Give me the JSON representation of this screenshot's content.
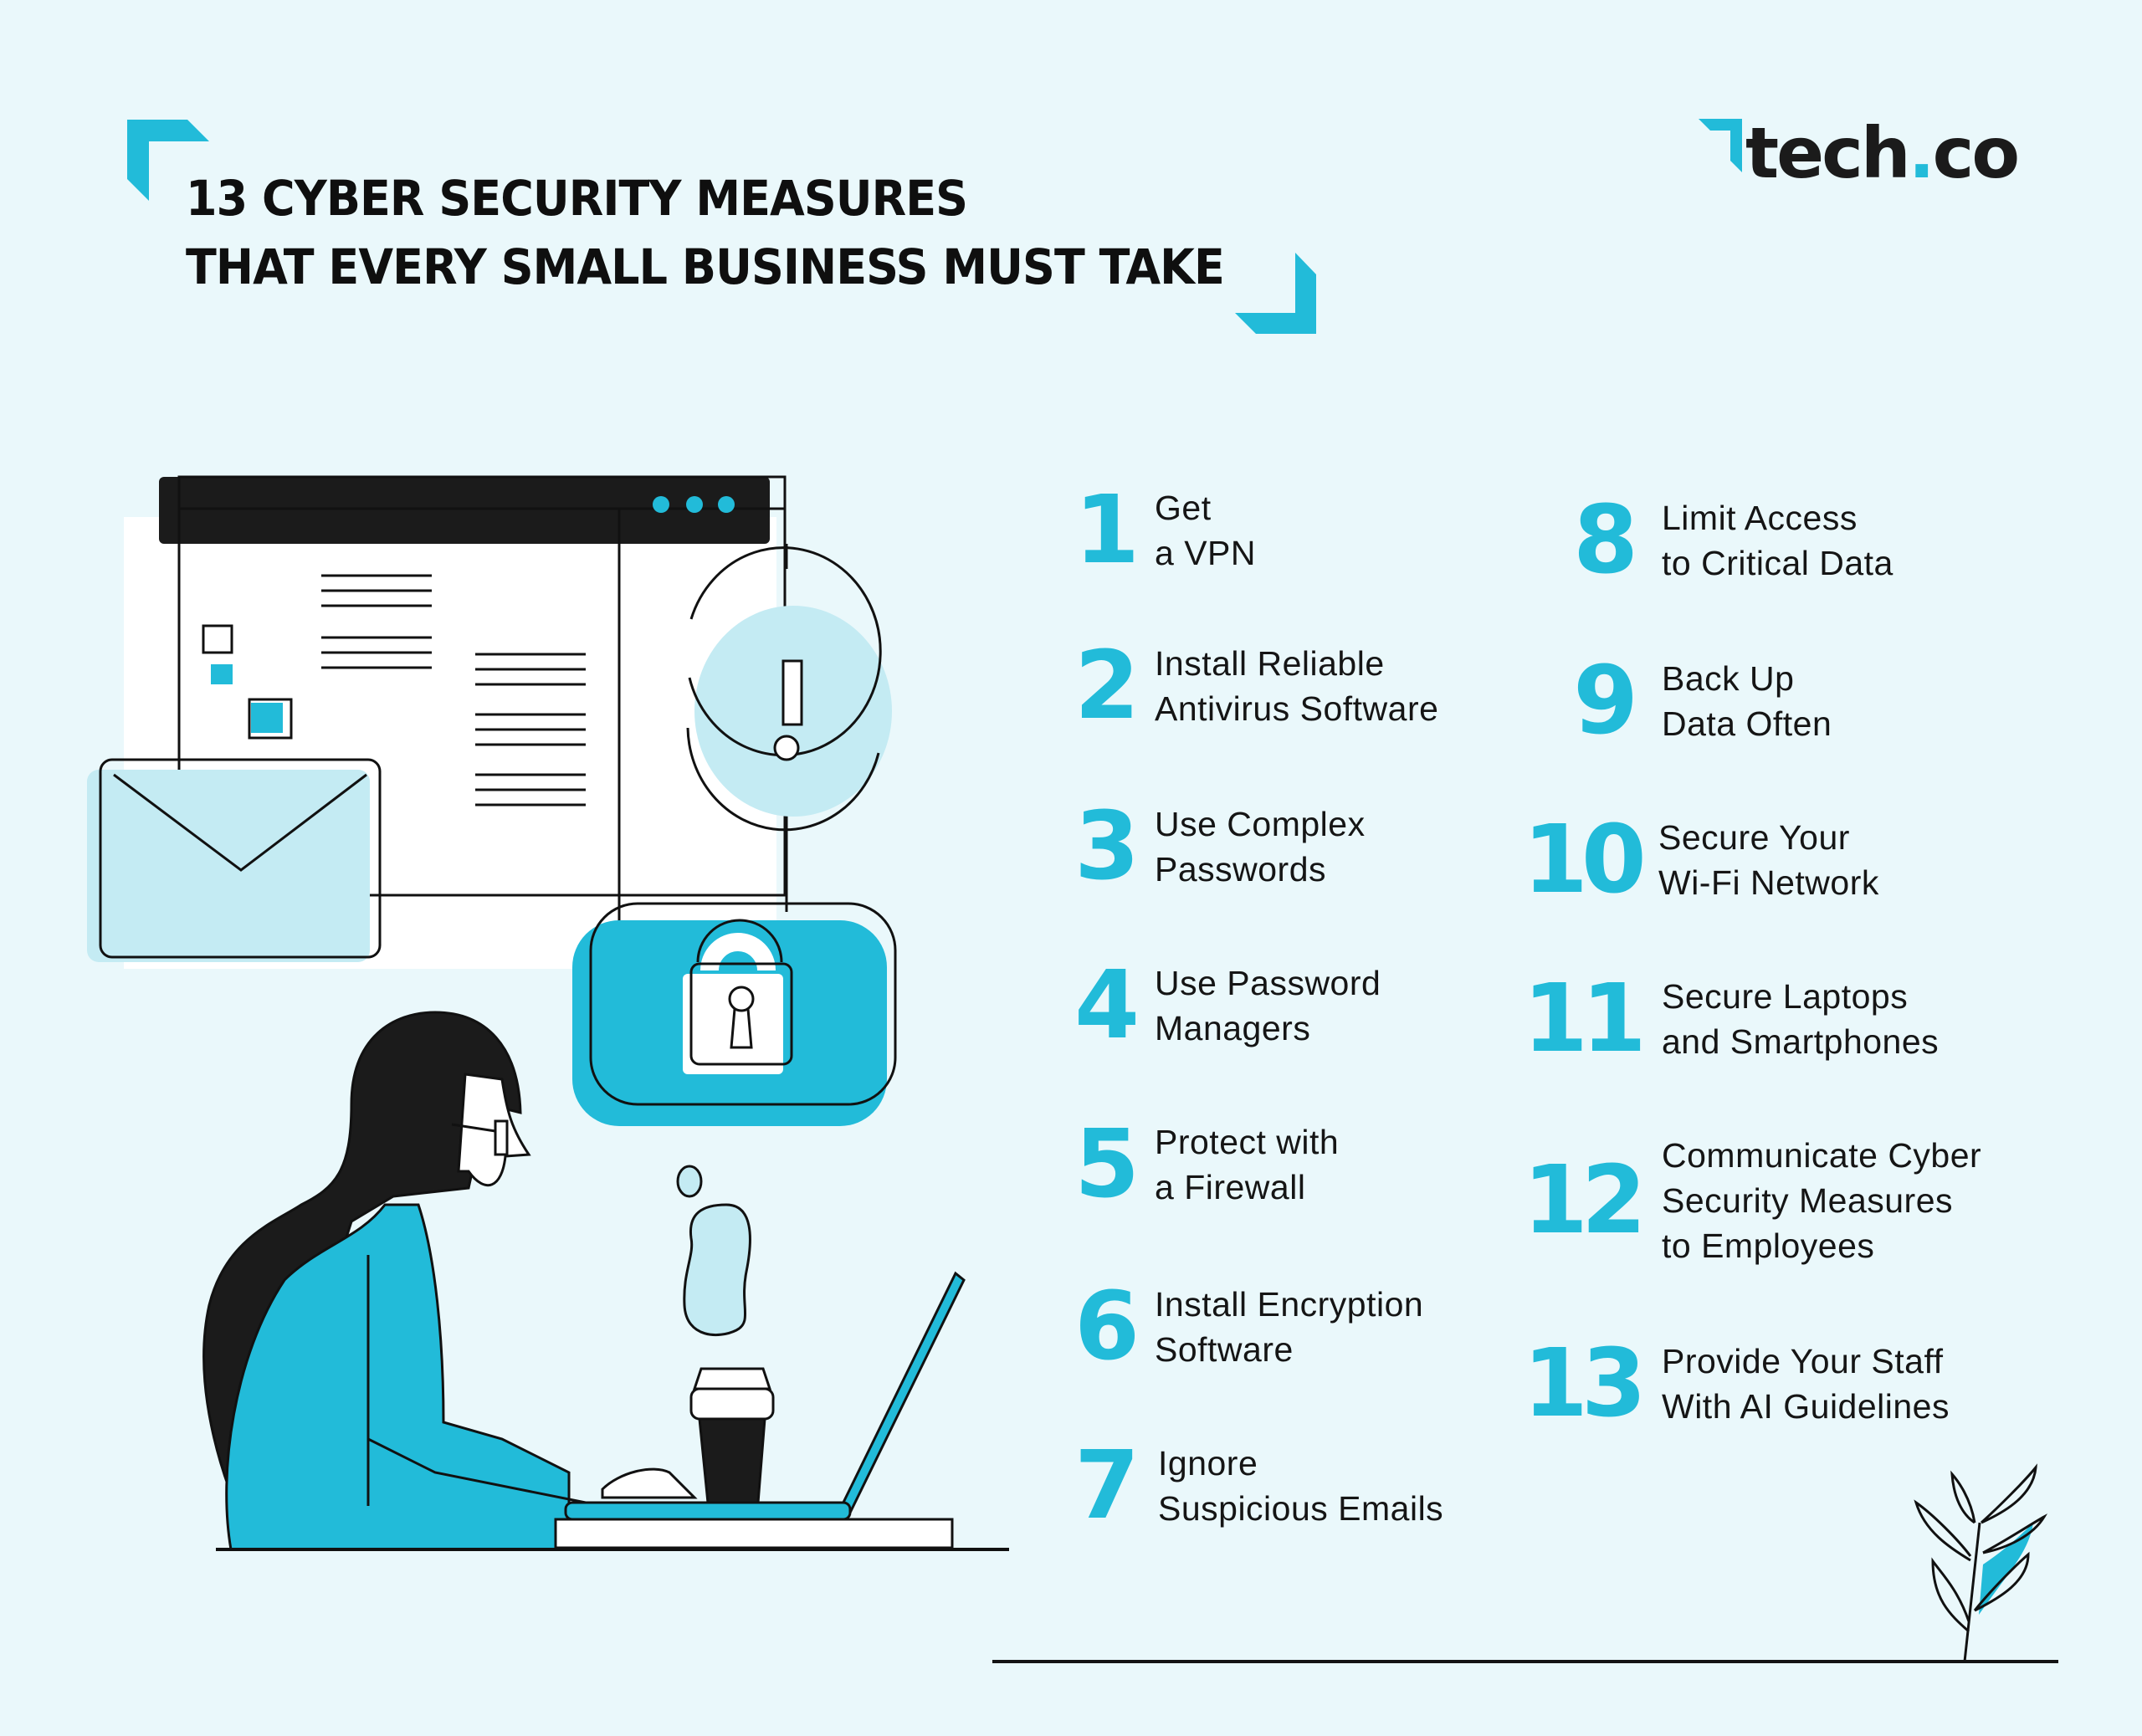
{
  "header": {
    "title_lines": [
      "13 CYBER SECURITY MEASURES",
      "THAT EVERY SMALL BUSINESS MUST TAKE"
    ],
    "brand": {
      "name_part1": "tech",
      "dot": ".",
      "name_part2": "co",
      "accent_color": "#22bbd9"
    }
  },
  "colors": {
    "background": "#eaf8fb",
    "accent": "#22bbd9",
    "light_accent": "#c4ebf3",
    "ink": "#141414"
  },
  "illustration": {
    "icons": [
      "browser-window-icon",
      "envelope-icon",
      "warning-icon",
      "padlock-icon",
      "woman-at-laptop",
      "coffee-cup-icon",
      "plant-icon"
    ]
  },
  "measures": [
    {
      "number": "1",
      "lines": [
        "Get",
        "a VPN"
      ]
    },
    {
      "number": "2",
      "lines": [
        "Install Reliable",
        "Antivirus Software"
      ]
    },
    {
      "number": "3",
      "lines": [
        "Use Complex",
        "Passwords"
      ]
    },
    {
      "number": "4",
      "lines": [
        "Use Password",
        "Managers"
      ]
    },
    {
      "number": "5",
      "lines": [
        "Protect with",
        "a Firewall"
      ]
    },
    {
      "number": "6",
      "lines": [
        "Install Encryption",
        "Software"
      ]
    },
    {
      "number": "7",
      "lines": [
        "Ignore",
        "Suspicious Emails"
      ]
    },
    {
      "number": "8",
      "lines": [
        "Limit Access",
        "to Critical Data"
      ]
    },
    {
      "number": "9",
      "lines": [
        "Back Up",
        "Data Often"
      ]
    },
    {
      "number": "10",
      "lines": [
        "Secure Your",
        "Wi-Fi Network"
      ]
    },
    {
      "number": "11",
      "lines": [
        "Secure Laptops",
        "and Smartphones"
      ]
    },
    {
      "number": "12",
      "lines": [
        "Communicate Cyber",
        "Security Measures",
        "to Employees"
      ]
    },
    {
      "number": "13",
      "lines": [
        "Provide Your Staff",
        "With AI Guidelines"
      ]
    }
  ]
}
